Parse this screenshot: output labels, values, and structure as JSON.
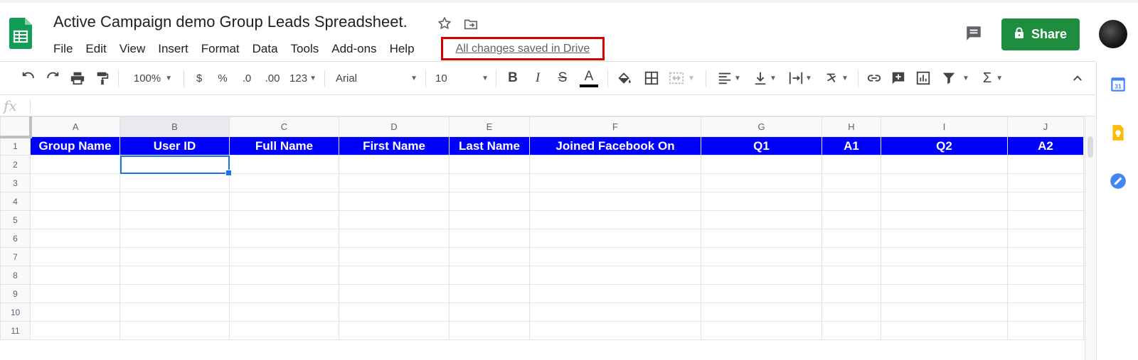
{
  "app": {
    "title": "Active Campaign demo Group Leads Spreadsheet.",
    "save_status": "All changes saved in Drive",
    "share_label": "Share",
    "brand_color": "#0f9d58",
    "share_color": "#1e8e3e",
    "highlight_color": "#d50000"
  },
  "menu": [
    "File",
    "Edit",
    "View",
    "Insert",
    "Format",
    "Data",
    "Tools",
    "Add-ons",
    "Help"
  ],
  "toolbar": {
    "zoom": "100%",
    "currency": "$",
    "percent": "%",
    "decrease_decimal": ".0",
    "increase_decimal": ".00",
    "more_formats": "123",
    "font": "Arial",
    "font_size": "10",
    "bold": "B",
    "italic": "I",
    "strikethrough": "S",
    "text_color": "A",
    "sum": "Σ"
  },
  "formula_bar": {
    "label": "fx",
    "value": ""
  },
  "sheet": {
    "columns": [
      "A",
      "B",
      "C",
      "D",
      "E",
      "F",
      "G",
      "H",
      "I",
      "J"
    ],
    "active_column": "B",
    "selected_cell": "B2",
    "header_fill": "#0000ff",
    "header_row": [
      "Group Name",
      "User ID",
      "Full Name",
      "First Name",
      "Last Name",
      "Joined Facebook On",
      "Q1",
      "A1",
      "Q2",
      "A2"
    ],
    "row_numbers": [
      "1",
      "2",
      "3",
      "4",
      "5",
      "6",
      "7",
      "8",
      "9",
      "10",
      "11"
    ]
  }
}
